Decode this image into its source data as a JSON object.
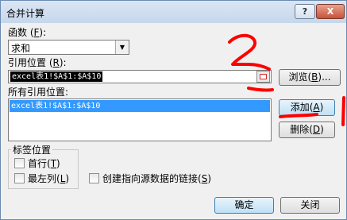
{
  "dialog": {
    "title": "合并计算",
    "help_button": "?",
    "close_button": "X"
  },
  "function": {
    "label_prefix": "函数 (",
    "label_key": "F",
    "label_suffix": "):",
    "selected": "求和"
  },
  "reference": {
    "label_prefix": "引用位置 (",
    "label_key": "R",
    "label_suffix": "):",
    "value": "excel表1!$A$1:$A$10",
    "browse_prefix": "浏览(",
    "browse_key": "B",
    "browse_suffix": ")..."
  },
  "all_references": {
    "label": "所有引用位置:",
    "items": [
      "excel表1!$A$1:$A$10"
    ]
  },
  "buttons": {
    "add_prefix": "添加(",
    "add_key": "A",
    "add_suffix": ")",
    "delete_prefix": "删除(",
    "delete_key": "D",
    "delete_suffix": ")",
    "ok": "确定",
    "close": "关闭"
  },
  "tag_position": {
    "title": "标签位置",
    "first_row_prefix": "首行(",
    "first_row_key": "T",
    "first_row_suffix": ")",
    "first_row_checked": false,
    "left_col_prefix": "最左列(",
    "left_col_key": "L",
    "left_col_suffix": ")",
    "left_col_checked": false
  },
  "link_source": {
    "prefix": "创建指向源数据的链接(",
    "key": "S",
    "suffix": ")",
    "checked": false
  },
  "annotations": {
    "number_label": "2",
    "color": "#ff0000"
  },
  "colors": {
    "selection": "#3399ff",
    "window_bg": "#f0f0f0"
  }
}
